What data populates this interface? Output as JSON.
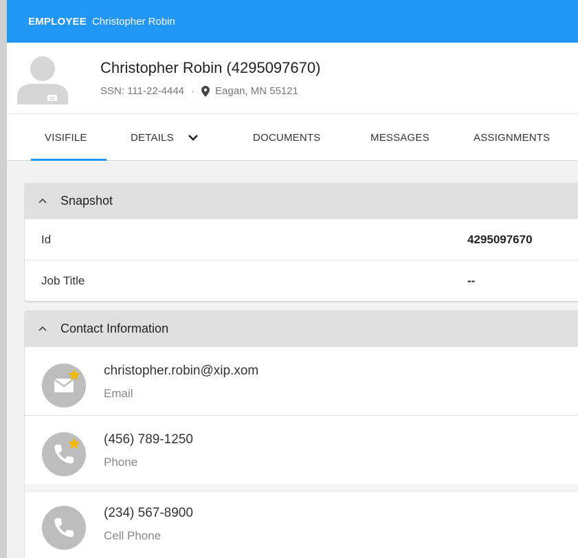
{
  "topbar": {
    "label": "EMPLOYEE",
    "name": "Christopher Robin"
  },
  "employee": {
    "title": "Christopher Robin (4295097670)",
    "ssn": "SSN: 111-22-4444",
    "separator": "·",
    "location": "Eagan, MN 55121"
  },
  "tabs": [
    {
      "label": "VISIFILE",
      "active": true
    },
    {
      "label": "DETAILS"
    },
    {
      "label": "DOCUMENTS"
    },
    {
      "label": "MESSAGES"
    },
    {
      "label": "ASSIGNMENTS"
    }
  ],
  "snapshot": {
    "title": "Snapshot",
    "rows": [
      {
        "key": "Id",
        "value": "4295097670"
      },
      {
        "key": "Job Title",
        "value": "--"
      }
    ]
  },
  "contact": {
    "title": "Contact Information",
    "items": [
      {
        "value": "christopher.robin@xip.xom",
        "label": "Email",
        "icon": "email-icon",
        "primary": true
      },
      {
        "value": "(456) 789-1250",
        "label": "Phone",
        "icon": "phone-icon",
        "primary": true
      },
      {
        "value": "(234) 567-8900",
        "label": "Cell Phone",
        "icon": "phone-icon",
        "primary": false
      }
    ]
  },
  "colors": {
    "accent": "#2196f3",
    "star": "#f5b800",
    "icon_bg": "#bdbdbd"
  }
}
